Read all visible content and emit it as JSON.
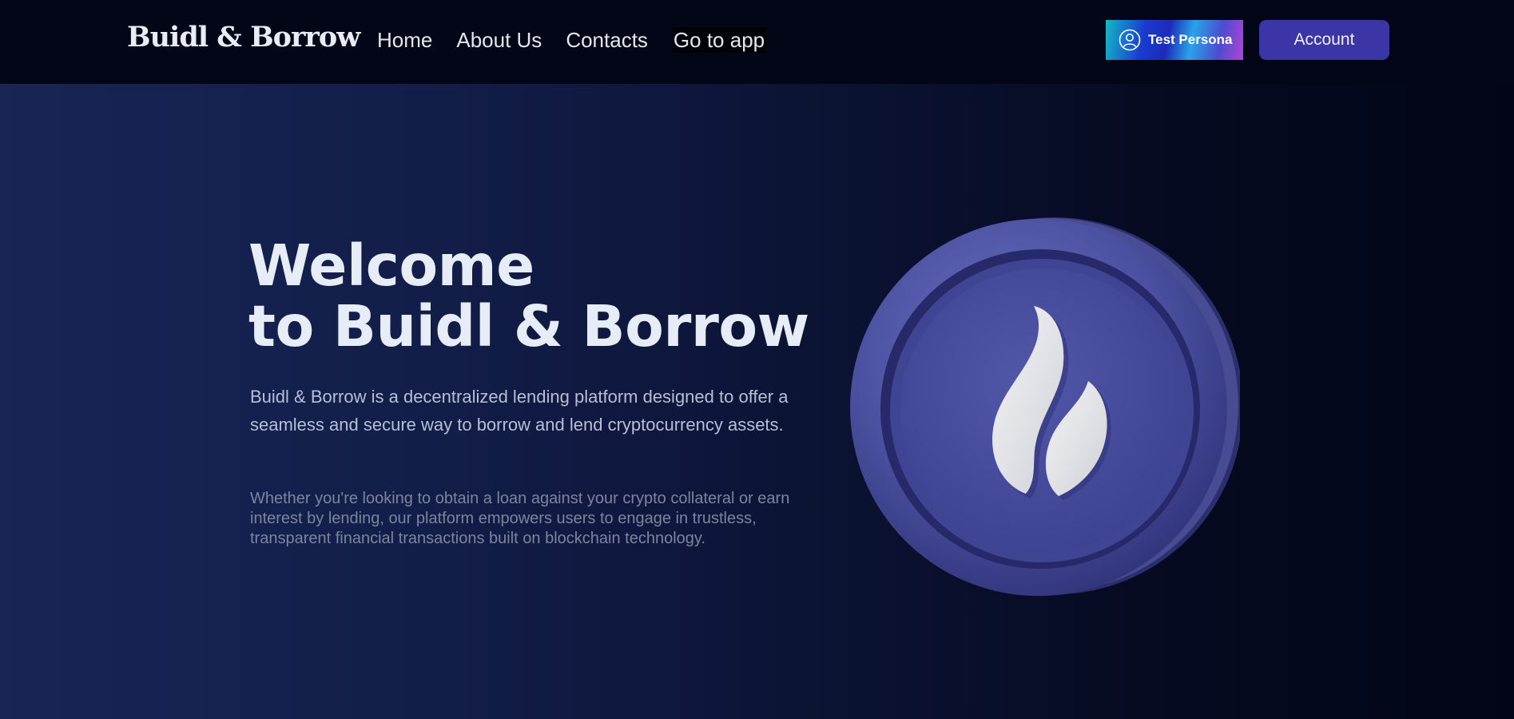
{
  "header": {
    "brand": "Buidl & Borrow",
    "nav": [
      {
        "label": "Home"
      },
      {
        "label": "About Us"
      },
      {
        "label": "Contacts"
      },
      {
        "label": "Go to app"
      }
    ],
    "persona_label": "Test Persona",
    "persona_icon": "user-circle-icon",
    "account_label": "Account"
  },
  "hero": {
    "title_line1": "Welcome",
    "title_line2": "to Buidl & Borrow",
    "lead": "Buidl & Borrow is a decentralized lending platform designed to offer a seamless and secure way to borrow and lend cryptocurrency assets.",
    "sub": "Whether you're looking to obtain a loan against your crypto collateral or earn interest by lending, our platform empowers users to engage in trustless, transparent financial transactions built on blockchain technology.",
    "coin_icon": "flame-coin-icon"
  },
  "colors": {
    "background": "#020617",
    "accent": "#3b35a6",
    "coin": "#4a4f9e",
    "text": "#e7edf7"
  }
}
